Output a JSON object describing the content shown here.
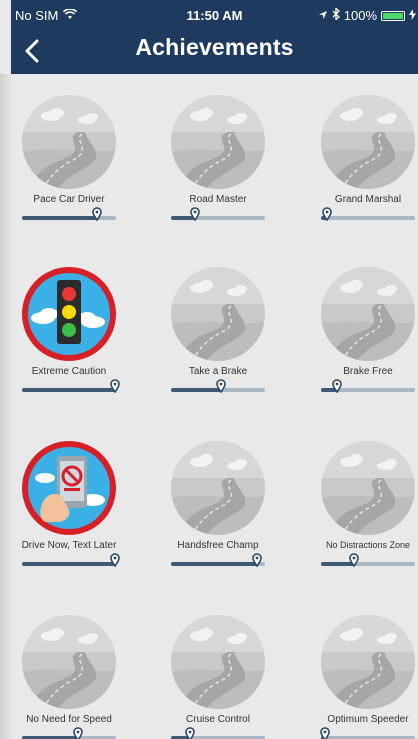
{
  "status_bar": {
    "carrier": "No SIM",
    "time": "11:50 AM",
    "battery": "100%",
    "icons": [
      "wifi-icon",
      "location-icon",
      "bluetooth-icon",
      "battery-icon",
      "charging-icon"
    ]
  },
  "nav": {
    "title": "Achievements",
    "back_icon": "chevron-left-icon"
  },
  "colors": {
    "header_bg": "#1f3a5f",
    "progress_track": "#a9b8c3",
    "progress_fill": "#3f5a75",
    "badge_ring_unlocked": "#d61f26",
    "battery": "#4cd964"
  },
  "achievements": [
    {
      "label": "Pace Car Driver",
      "progress": 0.8,
      "unlocked": false,
      "icon": "road-badge-icon"
    },
    {
      "label": "Road Master",
      "progress": 0.25,
      "unlocked": false,
      "icon": "road-badge-icon"
    },
    {
      "label": "Grand Marshal",
      "progress": 0.06,
      "unlocked": false,
      "icon": "road-badge-icon"
    },
    {
      "label": "Extreme Caution",
      "progress": 0.99,
      "unlocked": true,
      "icon": "traffic-light-badge-icon"
    },
    {
      "label": "Take a Brake",
      "progress": 0.53,
      "unlocked": false,
      "icon": "road-badge-icon"
    },
    {
      "label": "Brake Free",
      "progress": 0.17,
      "unlocked": false,
      "icon": "road-badge-icon"
    },
    {
      "label": "Drive Now, Text Later",
      "progress": 0.99,
      "unlocked": true,
      "icon": "no-texting-phone-badge-icon"
    },
    {
      "label": "Handsfree Champ",
      "progress": 0.91,
      "unlocked": false,
      "icon": "road-badge-icon"
    },
    {
      "label": "No Distractions Zone",
      "progress": 0.35,
      "unlocked": false,
      "icon": "road-badge-icon"
    },
    {
      "label": "No Need for Speed",
      "progress": 0.6,
      "unlocked": false,
      "icon": "road-badge-icon"
    },
    {
      "label": "Cruise Control",
      "progress": 0.2,
      "unlocked": false,
      "icon": "road-badge-icon"
    },
    {
      "label": "Optimum Speeder",
      "progress": 0.04,
      "unlocked": false,
      "icon": "road-badge-icon"
    }
  ]
}
